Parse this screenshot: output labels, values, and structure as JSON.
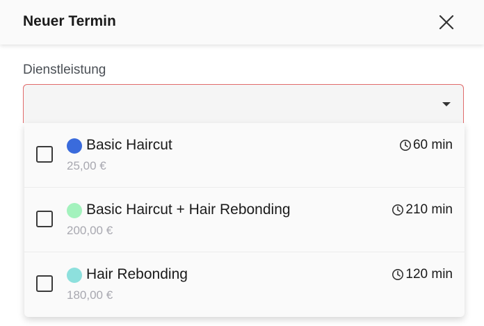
{
  "dialog": {
    "title": "Neuer Termin"
  },
  "form": {
    "service_label": "Dienstleistung",
    "service_value": ""
  },
  "options": [
    {
      "name": "Basic Haircut",
      "price": "25,00 €",
      "duration": "60 min",
      "color": "#3a6bdc",
      "checked": false
    },
    {
      "name": "Basic Haircut + Hair Rebonding",
      "price": "200,00 €",
      "duration": "210 min",
      "color": "#a3f2bd",
      "checked": false
    },
    {
      "name": "Hair Rebonding",
      "price": "180,00 €",
      "duration": "120 min",
      "color": "#8de0dd",
      "checked": false
    }
  ],
  "colors": {
    "error_border": "#e06a6a",
    "price_text": "#a8a8b0"
  },
  "icons": {
    "close": "close-icon",
    "dropdown": "caret-down-icon",
    "duration": "clock-icon"
  }
}
